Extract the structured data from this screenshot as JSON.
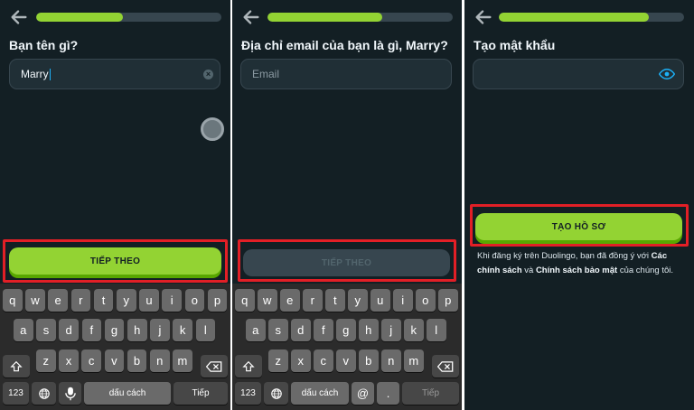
{
  "screens": [
    {
      "progress": 0.47,
      "question": "Bạn tên gì?",
      "field": {
        "value": "Marry",
        "placeholder": ""
      },
      "button": "TIẾP THEO",
      "keyboard": {
        "numbers": "123",
        "space": "dấu cách",
        "action": "Tiếp"
      }
    },
    {
      "progress": 0.62,
      "question": "Địa chỉ email của bạn là gì, Marry?",
      "field": {
        "value": "",
        "placeholder": "Email"
      },
      "button": "TIẾP THEO",
      "keyboard": {
        "numbers": "123",
        "space": "dấu cách",
        "at": "@",
        "dot": ".",
        "action": "Tiếp"
      }
    },
    {
      "progress": 0.81,
      "question": "Tạo mật khẩu",
      "field": {
        "value": "",
        "placeholder": ""
      },
      "button": "TẠO HỒ SƠ",
      "legal": {
        "prefix": "Khi đăng ký trên Duolingo, bạn đã đồng ý với ",
        "link1": "Các chính sách",
        "middle": " và ",
        "link2": "Chính sách bảo mật",
        "suffix": " của chúng tôi."
      }
    }
  ],
  "keyboard_rows": [
    [
      "q",
      "w",
      "e",
      "r",
      "t",
      "y",
      "u",
      "i",
      "o",
      "p"
    ],
    [
      "a",
      "s",
      "d",
      "f",
      "g",
      "h",
      "j",
      "k",
      "l"
    ],
    [
      "z",
      "x",
      "c",
      "v",
      "b",
      "n",
      "m"
    ]
  ],
  "icons": {
    "back": "arrow-left-icon",
    "clear": "clear-circle-icon",
    "eye": "eye-icon",
    "shift": "shift-icon",
    "delete": "backspace-icon",
    "globe": "globe-icon",
    "mic": "microphone-icon"
  },
  "colors": {
    "background": "#131f24",
    "accent_green": "#93d333",
    "accent_green_shadow": "#58a700",
    "highlight_red": "#e21f26",
    "input_bg": "#202f36",
    "eye_blue": "#1cb0f6"
  }
}
